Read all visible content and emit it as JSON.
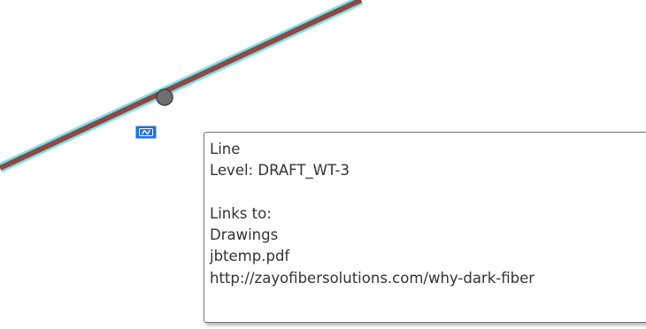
{
  "drawing": {
    "line": {
      "stroke_color": "#8b4a44",
      "highlight_color": "#7fe0ea",
      "vertex_color": "#6f6f6f"
    },
    "link_badge": {
      "icon": "link-icon",
      "color": "#1f6fe0"
    }
  },
  "tooltip": {
    "element_type": "Line",
    "level": "Level: DRAFT_WT-3",
    "links_heading": "Links to:",
    "links": [
      "Drawings",
      "jbtemp.pdf",
      "http://zayofibersolutions.com/why-dark-fiber"
    ]
  }
}
